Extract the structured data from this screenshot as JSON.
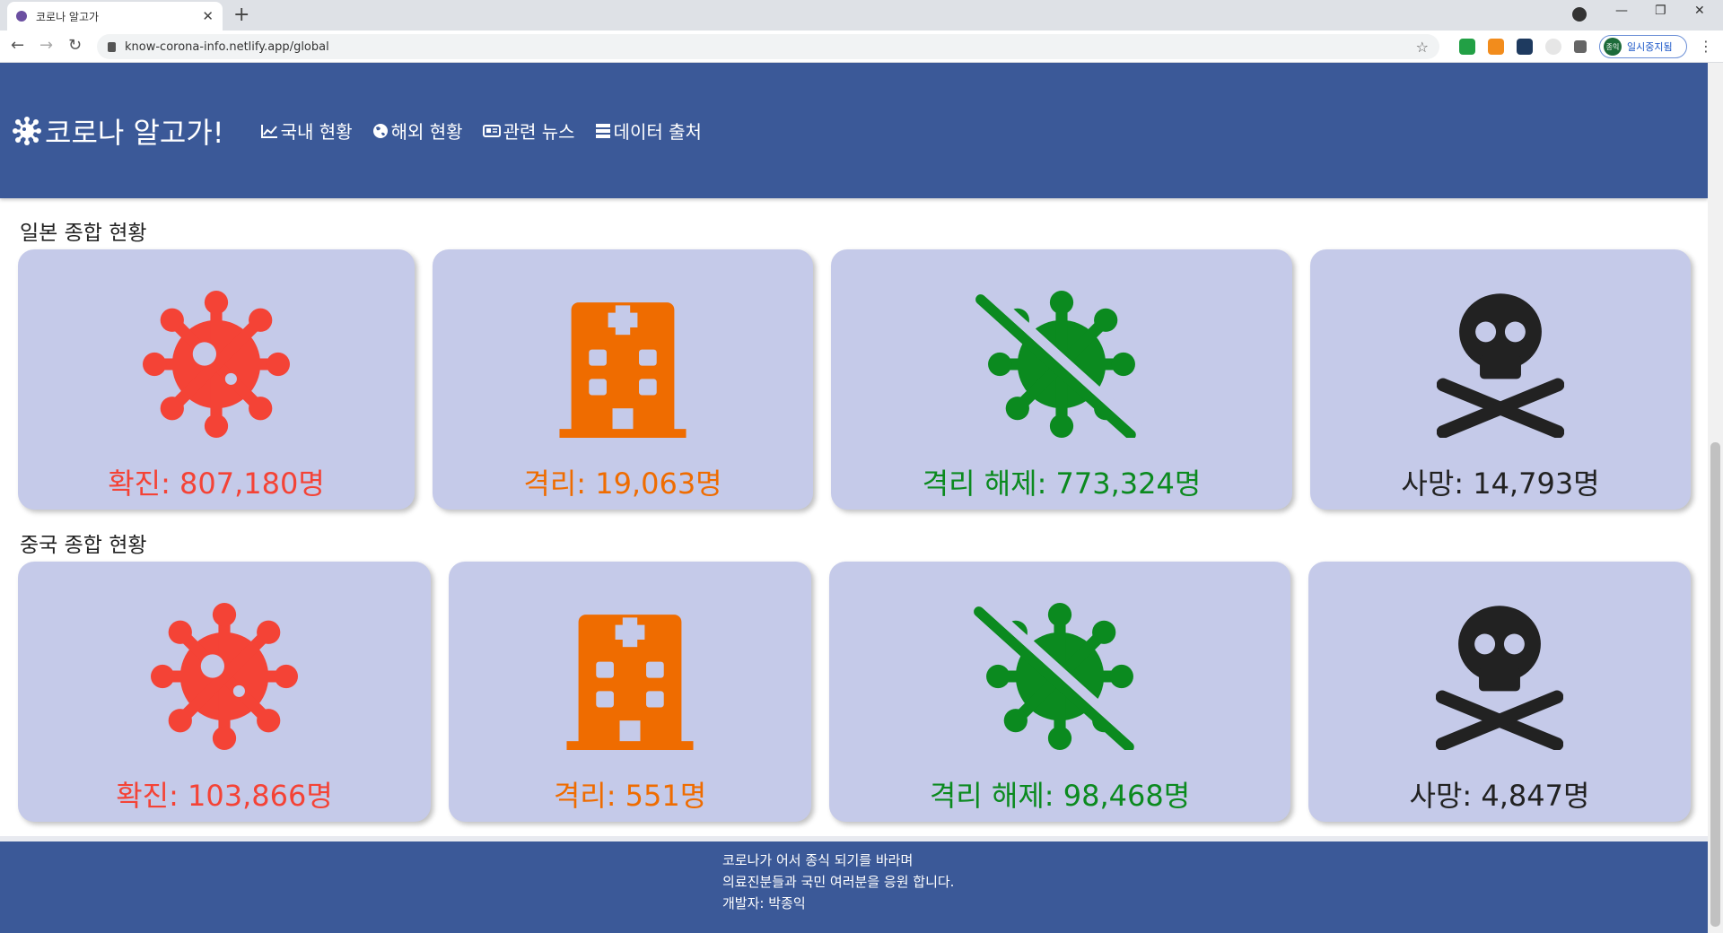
{
  "browser": {
    "tab_title": "코로나 알고가",
    "url": "know-corona-info.netlify.app/global",
    "profile_label": "일시중지됨",
    "profile_initials": "종익"
  },
  "header": {
    "brand": "코로나 알고가!",
    "nav": [
      {
        "label": "국내 현황",
        "icon": "chart-line-icon"
      },
      {
        "label": "해외 현황",
        "icon": "globe-icon"
      },
      {
        "label": "관련 뉴스",
        "icon": "newspaper-icon"
      },
      {
        "label": "데이터 출처",
        "icon": "server-icon"
      }
    ]
  },
  "sections": [
    {
      "title": "일본 종합 현황",
      "confirmed": "확진: 807,180명",
      "isolated": "격리: 19,063명",
      "released": "격리 해제: 773,324명",
      "deaths": "사망: 14,793명"
    },
    {
      "title": "중국 종합 현황",
      "confirmed": "확진: 103,866명",
      "isolated": "격리: 551명",
      "released": "격리 해제: 98,468명",
      "deaths": "사망: 4,847명"
    }
  ],
  "colors": {
    "header_bg": "#3b5998",
    "card_bg": "#c5cae9",
    "confirmed": "#f44336",
    "isolated": "#ef6c00",
    "released": "#0b8a1f",
    "deaths": "#222222"
  },
  "footer": {
    "line1": "코로나가 어서 종식 되기를 바라며",
    "line2": "의료진분들과 국민 여러분을 응원 합니다.",
    "line3": "개발자: 박종익"
  }
}
